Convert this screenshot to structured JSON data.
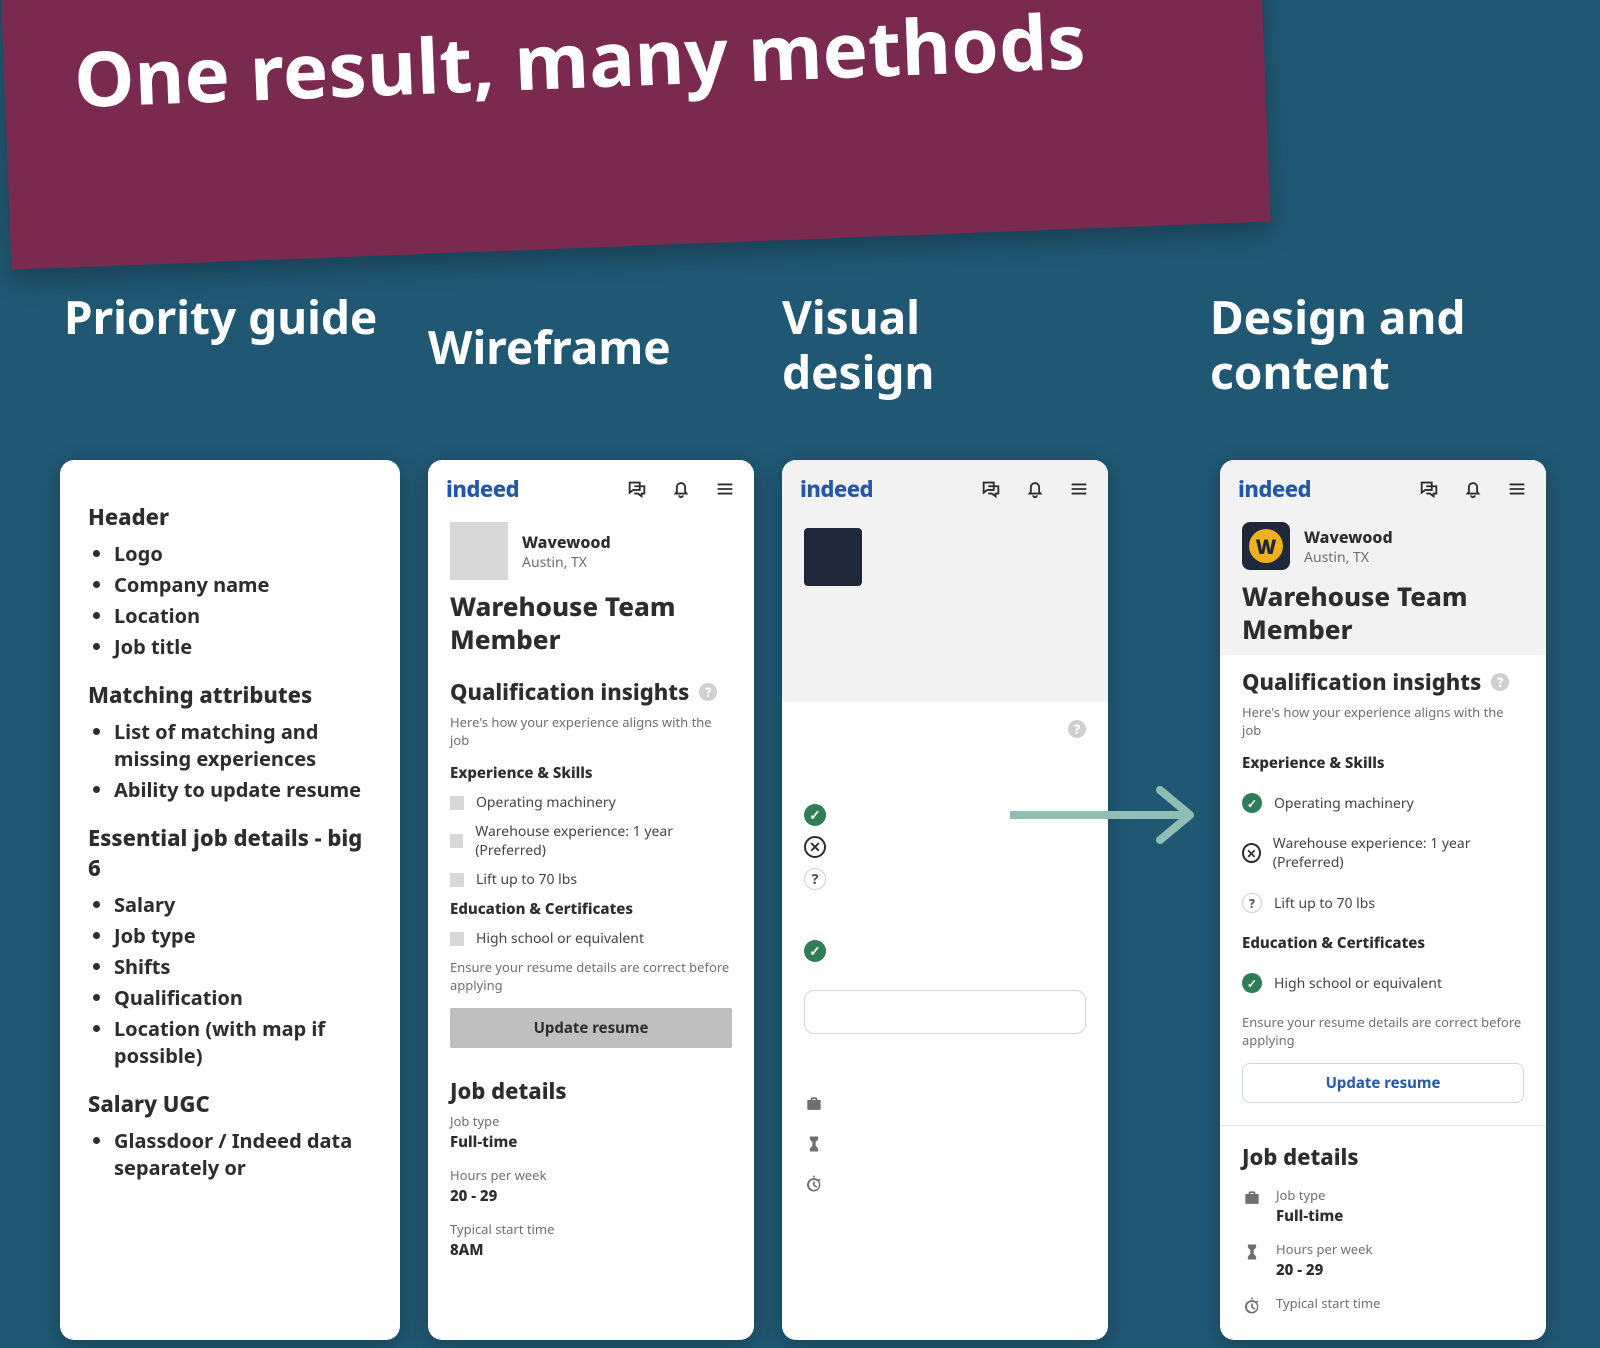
{
  "banner": {
    "title": "One result, many methods"
  },
  "columns": {
    "priority_guide": "Priority guide",
    "wireframe": "Wireframe",
    "visual_design": "Visual design",
    "design_content": "Design and content"
  },
  "priority_guide": {
    "sections": [
      {
        "title": "Header",
        "items": [
          "Logo",
          "Company name",
          "Location",
          "Job title"
        ]
      },
      {
        "title": "Matching attributes",
        "items": [
          "List of matching and missing experiences",
          "Ability to update resume"
        ]
      },
      {
        "title": "Essential job details - big 6",
        "items": [
          "Salary",
          "Job type",
          "Shifts",
          "Qualification",
          "Location (with map if possible)"
        ]
      },
      {
        "title": "Salary UGC",
        "items": [
          "Glassdoor / Indeed data separately or"
        ]
      }
    ]
  },
  "mobile": {
    "brand": "indeed",
    "company": {
      "name": "Wavewood",
      "location": "Austin, TX"
    },
    "job_title": "Warehouse Team Member",
    "qualification": {
      "heading": "Qualification insights",
      "sub": "Here's how your experience aligns with the job",
      "exp_heading": "Experience & Skills",
      "exp_items": [
        {
          "text": "Operating machinery",
          "status": "check"
        },
        {
          "text": "Warehouse experience: 1 year (Preferred)",
          "status": "x"
        },
        {
          "text": "Lift up to 70 lbs",
          "status": "q"
        }
      ],
      "edu_heading": "Education & Certificates",
      "edu_items": [
        {
          "text": "High school or equivalent",
          "status": "check"
        }
      ],
      "hint": "Ensure your resume details are correct before applying",
      "cta": "Update resume"
    },
    "details": {
      "heading": "Job details",
      "items": [
        {
          "label": "Job type",
          "value": "Full-time",
          "icon": "briefcase"
        },
        {
          "label": "Hours per week",
          "value": "20 - 29",
          "icon": "hourglass"
        },
        {
          "label": "Typical start time",
          "value": "8AM",
          "icon": "stopwatch"
        }
      ]
    }
  }
}
